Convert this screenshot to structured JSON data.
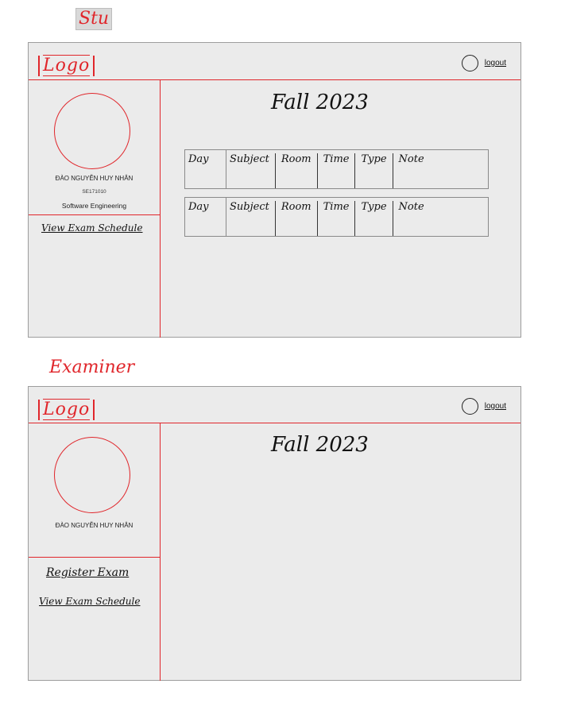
{
  "sections": {
    "student": {
      "label": "Stu",
      "logo": "Logo",
      "logout": "logout",
      "profile": {
        "name": "ĐÀO NGUYỄN HUY NHÂN",
        "student_id": "SE171010",
        "major": "Software Engineering"
      },
      "menu": [
        "View Exam Schedule"
      ],
      "term": "Fall 2023",
      "schedule_header": [
        "Day",
        "Subject",
        "Room",
        "Time",
        "Type",
        "Note"
      ]
    },
    "examiner": {
      "label": "Examiner",
      "logo": "Logo",
      "logout": "logout",
      "profile": {
        "name": "ĐÀO NGUYỄN HUY NHÂN"
      },
      "menu": [
        "Register Exam",
        "View Exam Schedule"
      ],
      "term": "Fall 2023"
    }
  },
  "colors": {
    "accent": "#e0262b",
    "frame_bg": "#ebebeb",
    "frame_border": "#9d9d9d"
  }
}
